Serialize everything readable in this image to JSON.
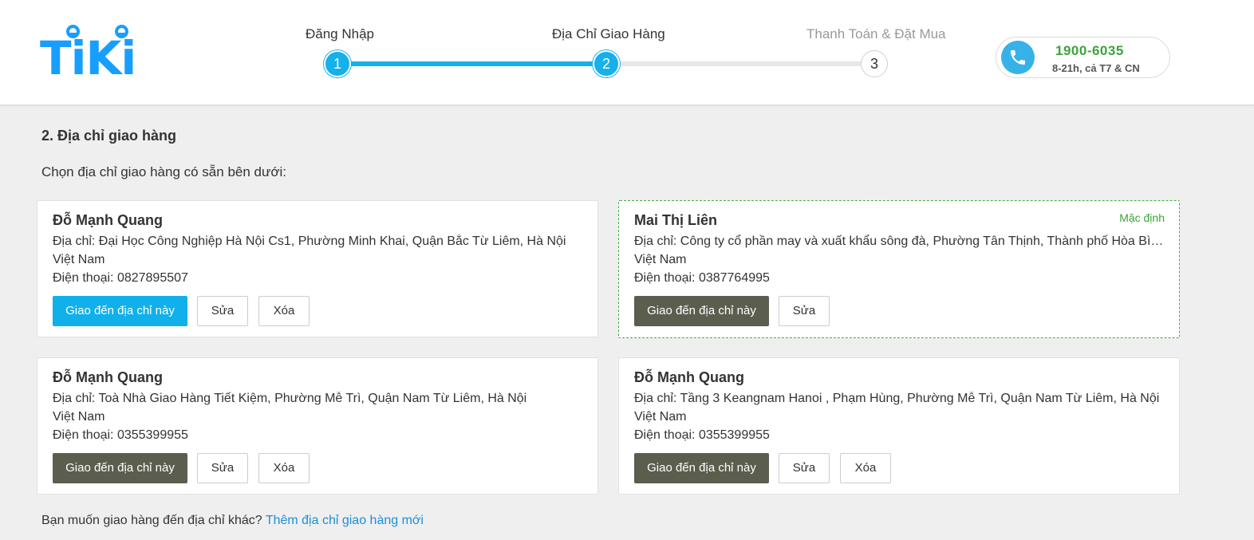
{
  "header": {
    "logo_text": "TiKi",
    "steps": [
      {
        "number": "1",
        "label": "Đăng Nhập",
        "state": "done"
      },
      {
        "number": "2",
        "label": "Địa Chỉ Giao Hàng",
        "state": "current"
      },
      {
        "number": "3",
        "label": "Thanh Toán & Đặt Mua",
        "state": "pending"
      }
    ],
    "hotline": {
      "number": "1900-6035",
      "hours": "8-21h, cả T7 & CN",
      "icon": "phone-icon"
    }
  },
  "main": {
    "title": "2. Địa chỉ giao hàng",
    "subtitle": "Chọn địa chỉ giao hàng có sẵn bên dưới:",
    "addresses": [
      {
        "name": "Đỗ Mạnh Quang",
        "address": "Địa chỉ: Đại Học Công Nghiệp Hà Nội Cs1, Phường Minh Khai, Quận Bắc Từ Liêm, Hà Nội",
        "country": "Việt Nam",
        "phone": "Điện thoại: 0827895507",
        "ship_label": "Giao đến địa chỉ này",
        "edit_label": "Sửa",
        "delete_label": "Xóa"
      },
      {
        "name": "Mai Thị Liên",
        "badge": "Mặc định",
        "address": "Địa chỉ: Công ty cổ phần may và xuất khẩu sông đà, Phường Tân Thịnh, Thành phố Hòa Bình, Hòa Bình",
        "country": "Việt Nam",
        "phone": "Điện thoại: 0387764995",
        "ship_label": "Giao đến địa chỉ này",
        "edit_label": "Sửa"
      },
      {
        "name": "Đỗ Mạnh Quang",
        "address": "Địa chỉ: Toà Nhà Giao Hàng Tiết Kiệm, Phường Mễ Trì, Quận Nam Từ Liêm, Hà Nội",
        "country": "Việt Nam",
        "phone": "Điện thoại: 0355399955",
        "ship_label": "Giao đến địa chỉ này",
        "edit_label": "Sửa",
        "delete_label": "Xóa"
      },
      {
        "name": "Đỗ Mạnh Quang",
        "address": "Địa chỉ: Tầng 3 Keangnam Hanoi , Phạm Hùng, Phường Mễ Trì, Quận Nam Từ Liêm, Hà Nội",
        "country": "Việt Nam",
        "phone": "Điện thoại: 0355399955",
        "ship_label": "Giao đến địa chỉ này",
        "edit_label": "Sửa",
        "delete_label": "Xóa"
      }
    ],
    "footer_text": "Bạn muốn giao hàng đến địa chỉ khác?",
    "footer_link": "Thêm địa chỉ giao hàng mới"
  },
  "colors": {
    "accent": "#16b0eb",
    "logo": "#189eff",
    "dark_button": "#5b5e4e",
    "default_border": "#3db33d",
    "link": "#1a8fd6"
  }
}
